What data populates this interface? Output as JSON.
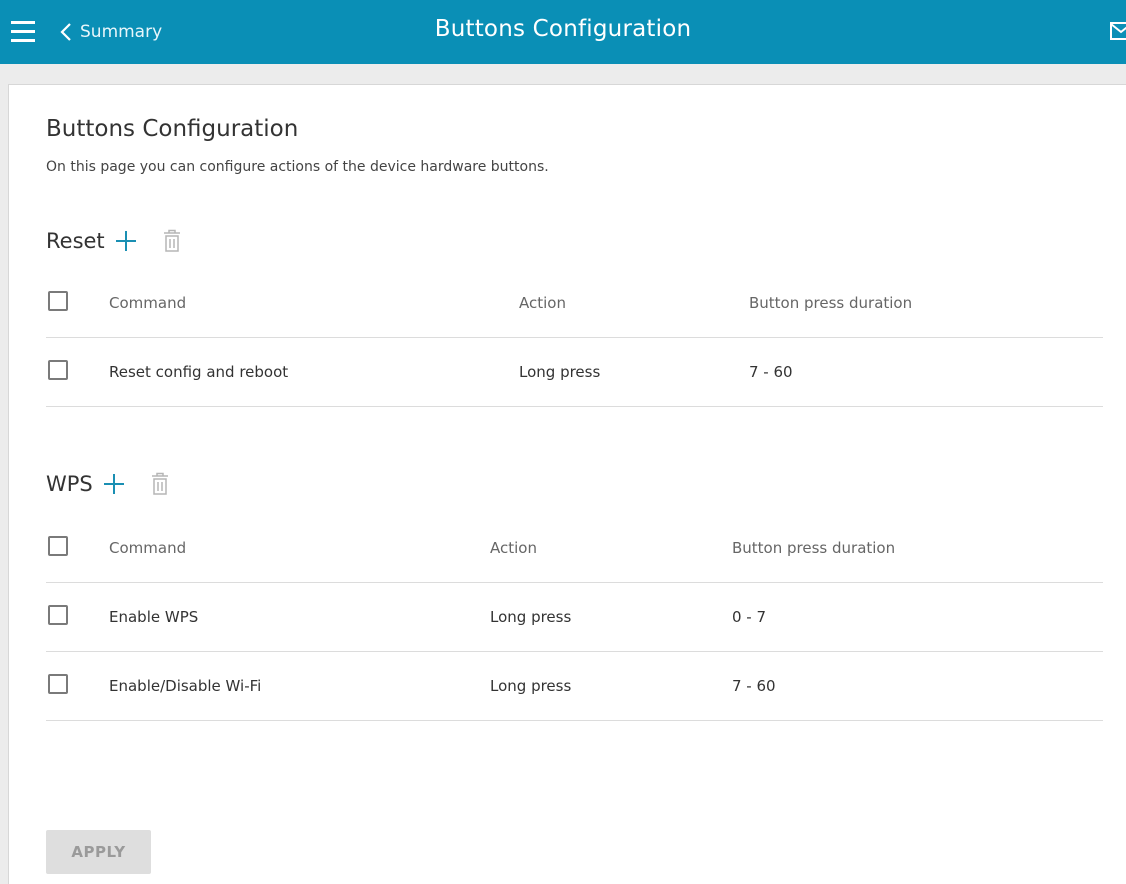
{
  "header": {
    "back_label": "Summary",
    "title": "Buttons Configuration"
  },
  "page": {
    "title": "Buttons Configuration",
    "description": "On this page you can configure actions of the device hardware buttons."
  },
  "sections": [
    {
      "label": "Reset",
      "columns": [
        "Command",
        "Action",
        "Button press duration"
      ],
      "rows": [
        {
          "command": "Reset config and reboot",
          "action": "Long press",
          "duration": "7 - 60"
        }
      ]
    },
    {
      "label": "WPS",
      "columns": [
        "Command",
        "Action",
        "Button press duration"
      ],
      "rows": [
        {
          "command": "Enable WPS",
          "action": "Long press",
          "duration": "0 - 7"
        },
        {
          "command": "Enable/Disable Wi-Fi",
          "action": "Long press",
          "duration": "7 - 60"
        }
      ]
    }
  ],
  "apply_label": "APPLY",
  "colors": {
    "accent": "#0a8fb6",
    "icon_accent": "#1a8fb3",
    "muted_icon": "#b5b5b5"
  },
  "icons": [
    "menu-icon",
    "chevron-left-icon",
    "mail-icon",
    "plus-icon",
    "trash-icon"
  ]
}
